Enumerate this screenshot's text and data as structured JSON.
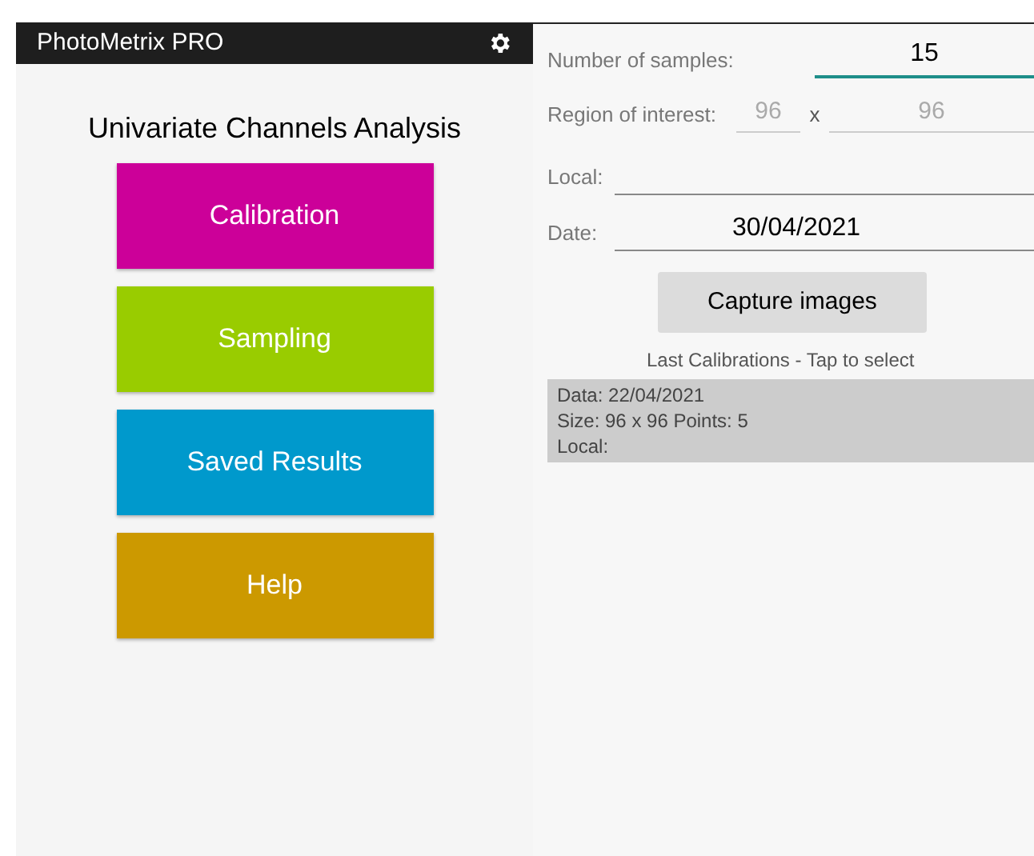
{
  "app_bar": {
    "title": "PhotoMetrix PRO"
  },
  "heading": "Univariate Channels Analysis",
  "menu": [
    {
      "label": "Calibration",
      "color": "#cc0099"
    },
    {
      "label": "Sampling",
      "color": "#99cc00"
    },
    {
      "label": "Saved Results",
      "color": "#0099cc"
    },
    {
      "label": "Help",
      "color": "#cc9900"
    }
  ],
  "form": {
    "samples_label": "Number of samples:",
    "samples_value": "15",
    "roi_label": "Region of interest:",
    "roi_width_placeholder": "96",
    "roi_separator": "x",
    "roi_height_placeholder": "96",
    "local_label": "Local:",
    "date_label": "Date:",
    "date_value": "30/04/2021"
  },
  "capture_button": "Capture images",
  "calibrations_title": "Last Calibrations - Tap to select",
  "calibrations": [
    {
      "lines": [
        "Data: 22/04/2021",
        "Size: 96 x 96 Points: 5",
        "Local:"
      ]
    }
  ]
}
